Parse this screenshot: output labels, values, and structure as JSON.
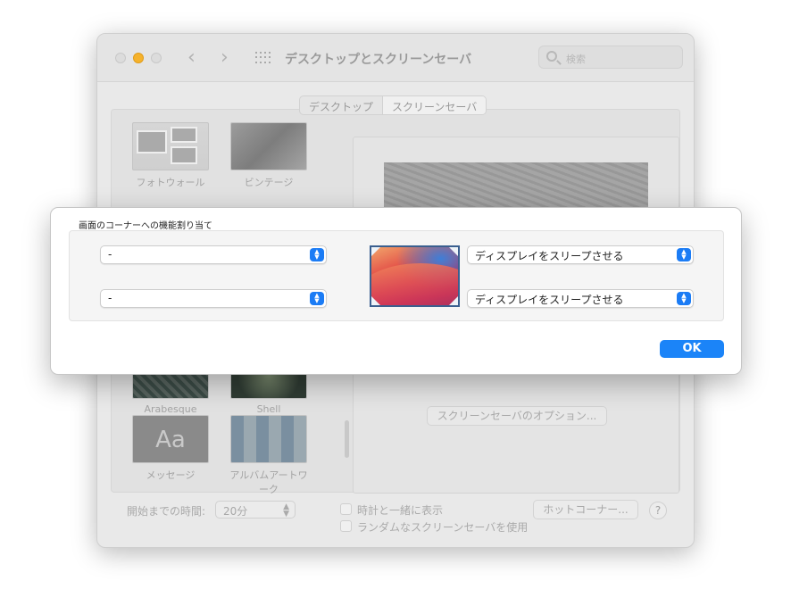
{
  "window": {
    "title": "デスクトップとスクリーンセーバ",
    "search_placeholder": "検索",
    "back_glyph": "‹",
    "forward_glyph": "›",
    "traffic_lights": {
      "close": "#dcdcdc",
      "minimize": "#f5b22c",
      "zoom": "#dcdcdc"
    }
  },
  "tabs": [
    {
      "label": "デスクトップ",
      "selected": false
    },
    {
      "label": "スクリーンセーバ",
      "selected": true
    }
  ],
  "screensavers": [
    {
      "label": "フォトウォール"
    },
    {
      "label": "ビンテージ"
    },
    {
      "label": "Arabesque"
    },
    {
      "label": "Shell"
    },
    {
      "label": "メッセージ",
      "thumb_text": "Aa"
    },
    {
      "label": "アルバムアートワーク"
    }
  ],
  "options_button": "スクリーンセーバのオプション...",
  "bottom": {
    "start_after_label": "開始までの時間:",
    "start_after_value": "20分",
    "show_clock_label": "時計と一緒に表示",
    "random_label": "ランダムなスクリーンセーバを使用",
    "hot_corners_button": "ホットコーナー...",
    "help_glyph": "?"
  },
  "sheet": {
    "title": "画面のコーナーへの機能割り当て",
    "top_left_value": "-",
    "bottom_left_value": "-",
    "top_right_value": "ディスプレイをスリープさせる",
    "bottom_right_value": "ディスプレイをスリープさせる",
    "ok_label": "OK",
    "accent_color": "#1b84f8"
  }
}
